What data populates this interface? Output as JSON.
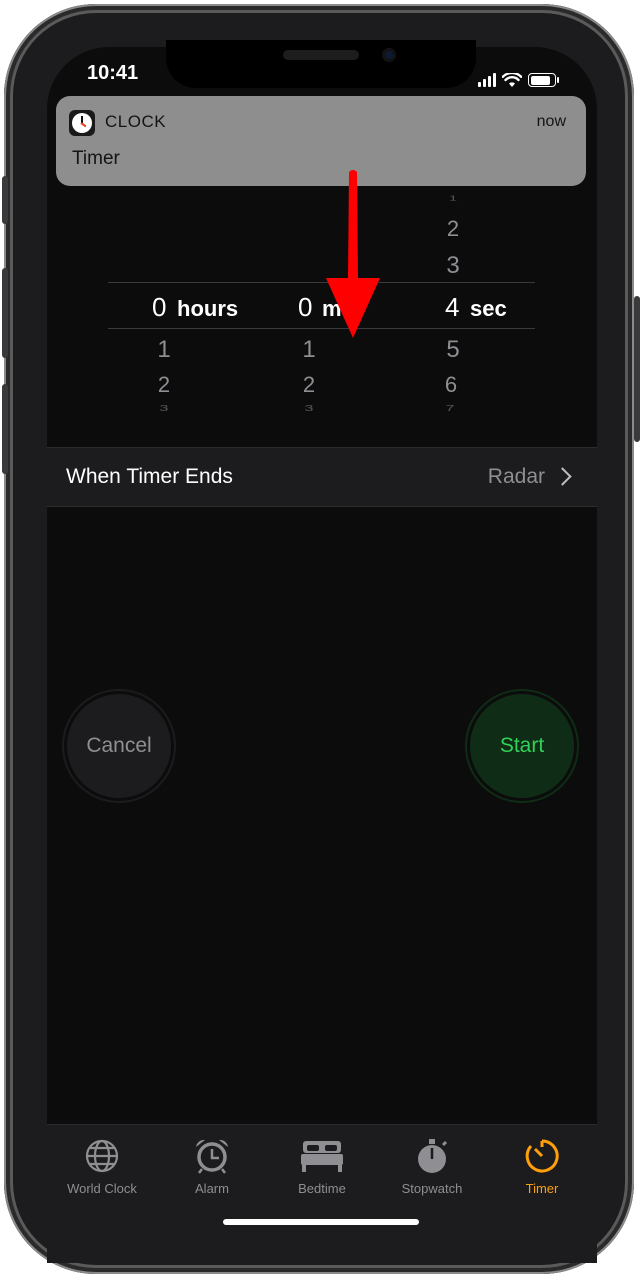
{
  "status_bar": {
    "time": "10:41"
  },
  "notification": {
    "app": "CLOCK",
    "time": "now",
    "title": "Timer"
  },
  "picker": {
    "hours_above": [],
    "minutes_above": [],
    "seconds_above": [
      "1",
      "2",
      "3"
    ],
    "hours": {
      "value": "0",
      "unit": "hours"
    },
    "minutes": {
      "value": "0",
      "unit": "min"
    },
    "seconds": {
      "value": "4",
      "unit": "sec"
    },
    "hours_below": [
      "1",
      "2",
      "3"
    ],
    "minutes_below": [
      "1",
      "2",
      "3"
    ],
    "seconds_below": [
      "5",
      "6",
      "7"
    ]
  },
  "timer_end": {
    "label": "When Timer Ends",
    "value": "Radar"
  },
  "buttons": {
    "cancel": "Cancel",
    "start": "Start"
  },
  "tabs": [
    {
      "label": "World Clock",
      "icon": "globe-icon"
    },
    {
      "label": "Alarm",
      "icon": "alarm-clock-icon"
    },
    {
      "label": "Bedtime",
      "icon": "bed-icon"
    },
    {
      "label": "Stopwatch",
      "icon": "stopwatch-icon"
    },
    {
      "label": "Timer",
      "icon": "timer-icon",
      "active": true
    }
  ],
  "colors": {
    "accent": "#ff9f0a",
    "start_green": "#30d158",
    "arrow": "#ff0000"
  }
}
